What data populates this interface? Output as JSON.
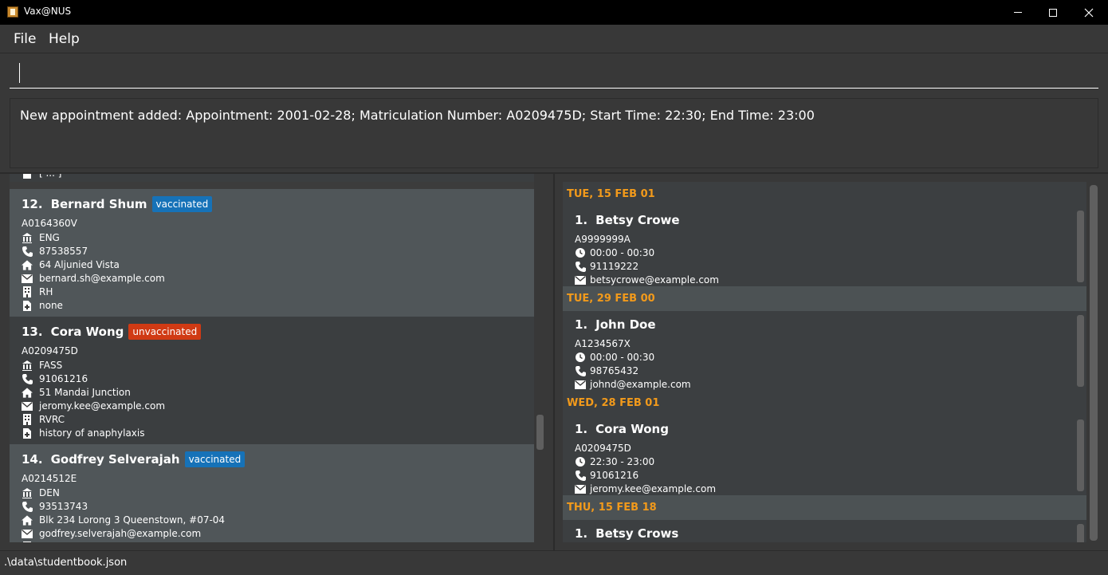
{
  "window": {
    "title": "Vax@NUS"
  },
  "menu": {
    "file": "File",
    "help": "Help"
  },
  "command": {
    "value": ""
  },
  "result": {
    "text": "New appointment added: Appointment: 2001-02-28; Matriculation Number: A0209475D; Start Time: 22:30; End Time: 23:00"
  },
  "partial_row": "[ ... ]",
  "persons": [
    {
      "index": "12.",
      "name": "Bernard Shum",
      "status": "vaccinated",
      "id": "A0164360V",
      "faculty": "ENG",
      "phone": "87538557",
      "address": "64 Aljunied Vista",
      "email": "bernard.sh@example.com",
      "residence": "RH",
      "medical": "none"
    },
    {
      "index": "13.",
      "name": "Cora Wong",
      "status": "unvaccinated",
      "id": "A0209475D",
      "faculty": "FASS",
      "phone": "91061216",
      "address": "51 Mandai Junction",
      "email": "jeromy.kee@example.com",
      "residence": "RVRC",
      "medical": "history of anaphylaxis"
    },
    {
      "index": "14.",
      "name": "Godfrey Selverajah",
      "status": "vaccinated",
      "id": "A0214512E",
      "faculty": "DEN",
      "phone": "93513743",
      "address": "Blk 234 Lorong 3 Queenstown, #07-04",
      "email": "godfrey.selverajah@example.com",
      "residence": "",
      "medical": ""
    }
  ],
  "schedule": [
    {
      "date": "TUE, 15 FEB 01",
      "appointments": [
        {
          "index": "1.",
          "name": "Betsy Crowe",
          "id": "A9999999A",
          "time": "00:00 - 00:30",
          "phone": "91119222",
          "email": "betsycrowe@example.com"
        }
      ]
    },
    {
      "date": "TUE, 29 FEB 00",
      "appointments": [
        {
          "index": "1.",
          "name": "John Doe",
          "id": "A1234567X",
          "time": "00:00 - 00:30",
          "phone": "98765432",
          "email": "johnd@example.com"
        }
      ]
    },
    {
      "date": "WED, 28 FEB 01",
      "appointments": [
        {
          "index": "1.",
          "name": "Cora Wong",
          "id": "A0209475D",
          "time": "22:30 - 23:00",
          "phone": "91061216",
          "email": "jeromy.kee@example.com"
        }
      ]
    },
    {
      "date": "THU, 15 FEB 18",
      "appointments": [
        {
          "index": "1.",
          "name": "Betsy Crows",
          "id": "",
          "time": "",
          "phone": "",
          "email": ""
        }
      ]
    }
  ],
  "status": {
    "path": ".\\data\\studentbook.json"
  },
  "colors": {
    "vaccinated": "#1672b8",
    "unvaccinated": "#d03a14",
    "date_header": "#f29a1b",
    "background": "#383838"
  },
  "icons": {
    "faculty": "faculty-icon",
    "phone": "phone-icon",
    "address": "home-icon",
    "email": "mail-icon",
    "residence": "building-icon",
    "medical": "medical-file-icon",
    "time": "clock-icon"
  }
}
